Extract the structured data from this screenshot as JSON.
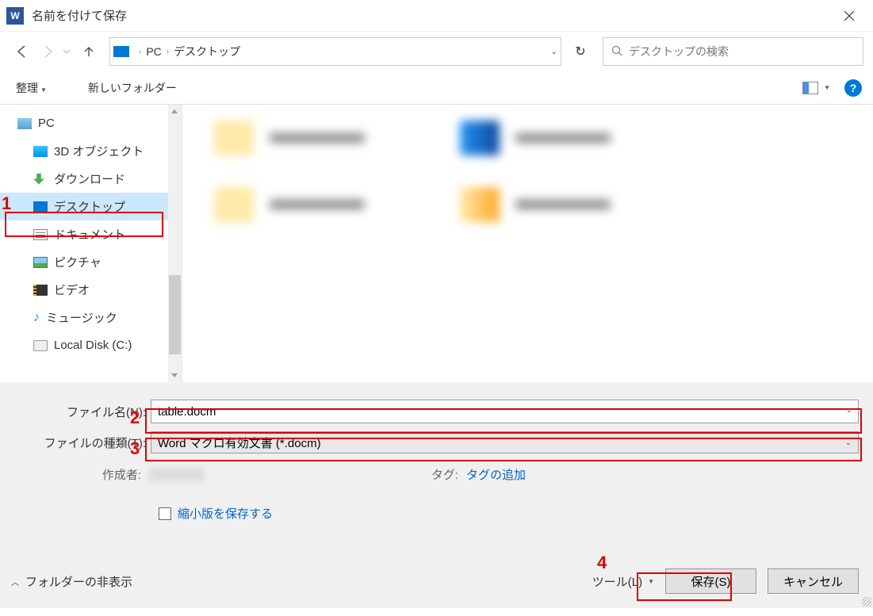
{
  "title": "名前を付けて保存",
  "breadcrumb": {
    "seg1": "PC",
    "seg2": "デスクトップ"
  },
  "search": {
    "placeholder": "デスクトップの検索"
  },
  "toolbar": {
    "organize": "整理",
    "new_folder": "新しいフォルダー"
  },
  "sidebar": {
    "pc": "PC",
    "items": [
      "3D オブジェクト",
      "ダウンロード",
      "デスクトップ",
      "ドキュメント",
      "ピクチャ",
      "ビデオ",
      "ミュージック",
      "Local Disk (C:)"
    ]
  },
  "form": {
    "filename_label": "ファイル名(N):",
    "filename_value": "table.docm",
    "filetype_label": "ファイルの種類(T):",
    "filetype_value": "Word マクロ有効文書 (*.docm)",
    "author_label": "作成者:",
    "tag_label": "タグ:",
    "tag_add": "タグの追加",
    "thumbnail": "縮小版を保存する"
  },
  "actions": {
    "hide_folders": "フォルダーの非表示",
    "tools": "ツール(L)",
    "save": "保存(S)",
    "cancel": "キャンセル"
  },
  "annotations": {
    "n1": "1",
    "n2": "2",
    "n3": "3",
    "n4": "4"
  }
}
